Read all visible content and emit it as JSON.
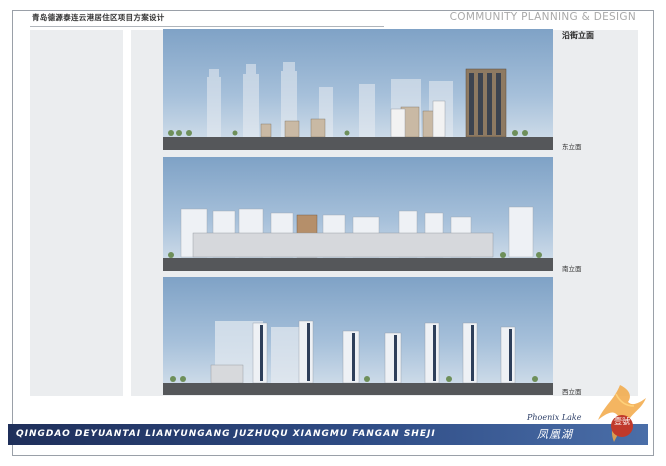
{
  "header": {
    "project_title": "青岛德源泰连云港居住区项目方案设计",
    "brand": "COMMUNITY PLANNING & DESIGN"
  },
  "sheet": {
    "heading": "沿街立面",
    "elevations": [
      {
        "caption": "东立面"
      },
      {
        "caption": "南立面"
      },
      {
        "caption": "西立面"
      }
    ]
  },
  "footer": {
    "pinyin": "QINGDAO DEYUANTAI LIANYUNGANG JUZHUQU XIANGMU FANGAN SHEJI",
    "lake_en": "Phoenix Lake",
    "lake_cn": "凤凰湖",
    "seal_text": "壹號"
  },
  "colors": {
    "sky_top": "#7fa2c6",
    "ground": "#55575a",
    "footer_band": "#2f4c85",
    "seal": "#c0392b"
  }
}
